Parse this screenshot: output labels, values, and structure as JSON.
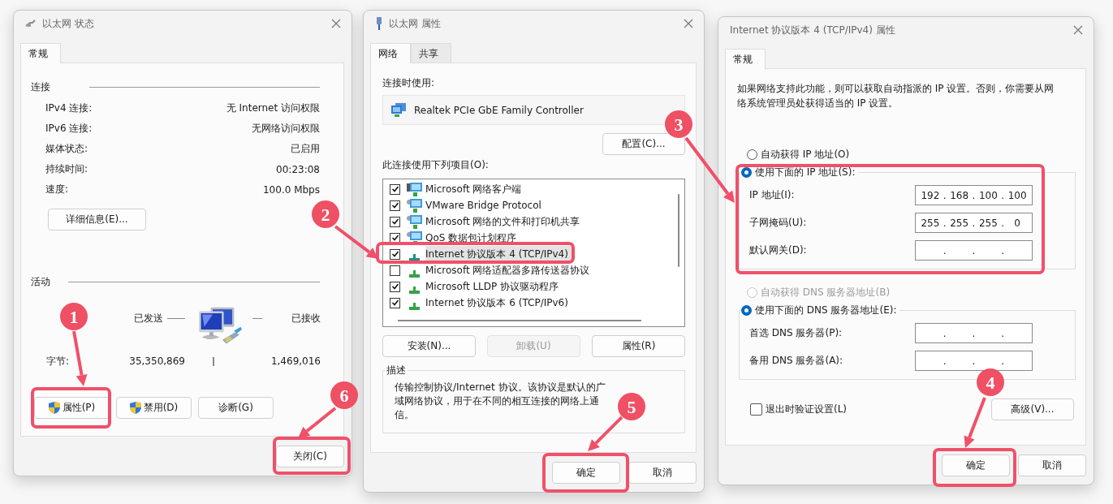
{
  "status_dialog": {
    "title": "以太网 状态",
    "tabs": [
      {
        "label": "常规",
        "selected": true
      }
    ],
    "connection": {
      "heading": "连接",
      "rows": [
        {
          "label": "IPv4 连接:",
          "value": "无 Internet 访问权限"
        },
        {
          "label": "IPv6 连接:",
          "value": "无网络访问权限"
        },
        {
          "label": "媒体状态:",
          "value": "已启用"
        },
        {
          "label": "持续时间:",
          "value": "00:23:08"
        },
        {
          "label": "速度:",
          "value": "100.0 Mbps"
        }
      ],
      "details_button": "详细信息(E)..."
    },
    "activity": {
      "heading": "活动",
      "sent_label": "已发送",
      "received_label": "已接收",
      "bytes_label": "字节:",
      "bytes_sent": "35,350,869",
      "bytes_received": "1,469,016"
    },
    "buttons": [
      {
        "label": "属性(P)",
        "shield": true
      },
      {
        "label": "禁用(D)",
        "shield": true
      },
      {
        "label": "诊断(G)",
        "shield": false
      }
    ],
    "close_button": "关闭(C)"
  },
  "properties_dialog": {
    "title": "以太网 属性",
    "tabs": [
      {
        "label": "网络",
        "selected": true
      },
      {
        "label": "共享",
        "selected": false
      }
    ],
    "connect_using_label": "连接时使用:",
    "adapter": "Realtek PCIe GbE Family Controller",
    "configure_button": "配置(C)...",
    "items_label": "此连接使用下列项目(O):",
    "items": [
      {
        "kind": "client",
        "label": "Microsoft 网络客户端",
        "checked": true,
        "selected": false
      },
      {
        "kind": "service",
        "label": "VMware Bridge Protocol",
        "checked": true,
        "selected": false
      },
      {
        "kind": "service",
        "label": "Microsoft 网络的文件和打印机共享",
        "checked": true,
        "selected": false
      },
      {
        "kind": "service",
        "label": "QoS 数据包计划程序",
        "checked": true,
        "selected": false
      },
      {
        "kind": "protocol",
        "label": "Internet 协议版本 4 (TCP/IPv4)",
        "checked": true,
        "selected": true
      },
      {
        "kind": "protocol",
        "label": "Microsoft 网络适配器多路传送器协议",
        "checked": false,
        "selected": false
      },
      {
        "kind": "protocol",
        "label": "Microsoft LLDP 协议驱动程序",
        "checked": true,
        "selected": false
      },
      {
        "kind": "protocol",
        "label": "Internet 协议版本 6 (TCP/IPv6)",
        "checked": true,
        "selected": false
      }
    ],
    "item_buttons": [
      {
        "label": "安装(N)...",
        "disabled": false
      },
      {
        "label": "卸载(U)",
        "disabled": true
      },
      {
        "label": "属性(R)",
        "disabled": false
      }
    ],
    "description": {
      "heading": "描述",
      "text": "传输控制协议/Internet 协议。该协议是默认的广域网络协议，用于在不同的相互连接的网络上通信。"
    },
    "buttons": [
      "确定",
      "取消"
    ]
  },
  "ipv4_dialog": {
    "title": "Internet 协议版本 4 (TCP/IPv4) 属性",
    "tabs": [
      {
        "label": "常规",
        "selected": true
      }
    ],
    "intro": "如果网络支持此功能，则可以获取自动指派的 IP 设置。否则，你需要从网络系统管理员处获得适当的 IP 设置。",
    "ip_mode": [
      {
        "label": "自动获得 IP 地址(O)",
        "selected": false,
        "disabled": false
      },
      {
        "label": "使用下面的 IP 地址(S):",
        "selected": true,
        "disabled": false
      }
    ],
    "ip_fields": [
      {
        "label": "IP 地址(I):",
        "segments": [
          "192",
          ".",
          "168",
          ".",
          "100",
          ".",
          "100"
        ]
      },
      {
        "label": "子网掩码(U):",
        "segments": [
          "255",
          ".",
          "255",
          ".",
          "255",
          ".",
          "0"
        ]
      },
      {
        "label": "默认网关(D):",
        "segments": [
          ".",
          ".",
          "."
        ]
      }
    ],
    "dns_mode": [
      {
        "label": "自动获得 DNS 服务器地址(B)",
        "selected": false,
        "disabled": true
      },
      {
        "label": "使用下面的 DNS 服务器地址(E):",
        "selected": true,
        "disabled": false
      }
    ],
    "dns_fields": [
      {
        "label": "首选 DNS 服务器(P):",
        "segments": [
          ".",
          ".",
          "."
        ]
      },
      {
        "label": "备用 DNS 服务器(A):",
        "segments": [
          ".",
          ".",
          "."
        ]
      }
    ],
    "validate_checkbox": {
      "label": "退出时验证设置(L)",
      "checked": false
    },
    "advanced_button": "高级(V)...",
    "buttons": [
      "确定",
      "取消"
    ]
  },
  "annotations": [
    {
      "number": "1"
    },
    {
      "number": "2"
    },
    {
      "number": "3"
    },
    {
      "number": "4"
    },
    {
      "number": "5"
    },
    {
      "number": "6"
    }
  ]
}
